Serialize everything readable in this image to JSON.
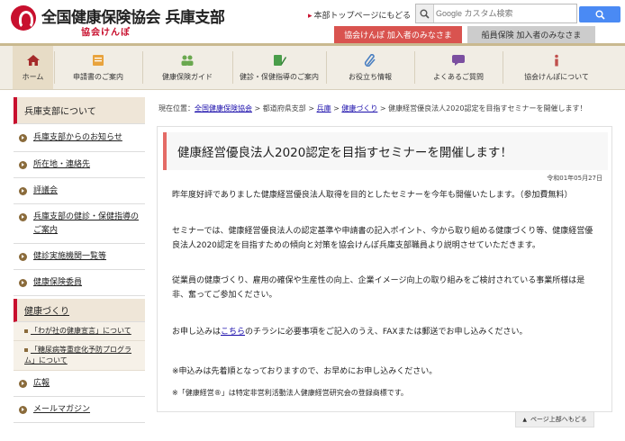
{
  "header": {
    "org_name": "全国健康保険協会 兵庫支部",
    "org_sub": "協会けんぽ",
    "top_link": "本部トップページにもどる",
    "search_placeholder": "Google カスタム検索",
    "tab_members": "協会けんぽ 加入者のみなさま",
    "tab_ship": "船員保険 加入者のみなさま"
  },
  "gnav": {
    "items": [
      {
        "label": "ホーム",
        "icon": "house-icon",
        "color": "#a52a2a"
      },
      {
        "label": "申請書のご案内",
        "icon": "document-icon",
        "color": "#e8a33d"
      },
      {
        "label": "健康保険ガイド",
        "icon": "people-icon",
        "color": "#6aa84f"
      },
      {
        "label": "健診・保健指導のご案内",
        "icon": "clipboard-pen-icon",
        "color": "#4a9e4a"
      },
      {
        "label": "お役立ち情報",
        "icon": "paperclip-icon",
        "color": "#4a7fc1"
      },
      {
        "label": "よくあるご質問",
        "icon": "speech-bubble-icon",
        "color": "#7b4fa0"
      },
      {
        "label": "協会けんぽについて",
        "icon": "info-icon",
        "color": "#c0504d"
      }
    ]
  },
  "sidebar": {
    "head1": "兵庫支部について",
    "items1": [
      "兵庫支部からのお知らせ",
      "所在地・連絡先",
      "評議会",
      "兵庫支部の健診・保健指導のご案内",
      "健診実施機関一覧等",
      "健康保険委員"
    ],
    "head2": "健康づくり",
    "subs": [
      "「わが社の健康宣言」について",
      "「糖尿病等重症化予防プログラム」について"
    ],
    "items2": [
      "広報",
      "メールマガジン"
    ]
  },
  "breadcrumb": {
    "prefix": "現在位置：",
    "c1": "全国健康保険協会",
    "sep1": " > 都道府県支部 > ",
    "c2": "兵庫",
    "sep2": " > ",
    "c3": "健康づくり",
    "sep3": " > 健康経営優良法人2020認定を目指すセミナーを開催します！"
  },
  "article": {
    "title": "健康経営優良法人2020認定を目指すセミナーを開催します！",
    "date": "令和01年05月27日",
    "p1": "昨年度好評でありました健康経営優良法人取得を目的としたセミナーを今年も開催いたします。（参加費無料）",
    "p2": "セミナーでは、健康経営優良法人の認定基準や申請書の記入ポイント、今から取り組める健康づくり等、健康経営優良法人2020認定を目指すための傾向と対策を協会けんぽ兵庫支部職員より説明させていただきます。",
    "p3": "従業員の健康づくり、雇用の確保や生産性の向上、企業イメージ向上の取り組みをご検討されている事業所様は是非、奮ってご参加ください。",
    "p4_pre": "お申し込みは",
    "p4_link": "こちら",
    "p4_post": "のチラシに必要事項をご記入のうえ、FAXまたは郵送でお申し込みください。",
    "p5": "※申込みは先着順となっておりますので、お早めにお申し込みください。",
    "p6": "※「健康経営®」は特定非営利活動法人健康経営研究会の登録商標です。"
  },
  "back_top": "ページ上部へもどる"
}
